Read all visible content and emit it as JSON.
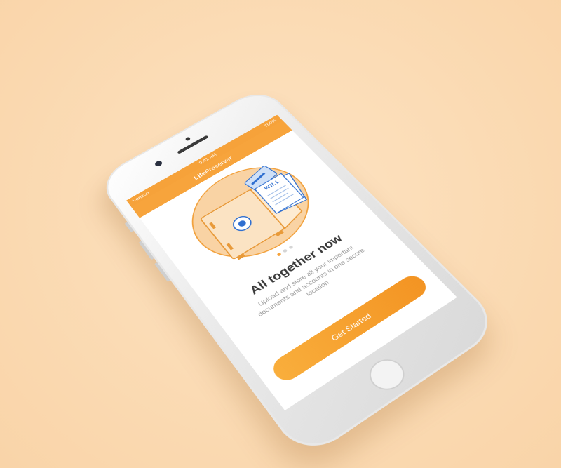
{
  "status_bar": {
    "carrier": "Verizon",
    "time": "9:41 AM",
    "battery": "100%"
  },
  "nav_bar": {
    "app_name_bold": "Life",
    "app_name_rest": "Preserver"
  },
  "illustration": {
    "document_label": "WILL"
  },
  "pager": {
    "count": 3,
    "active_index": 0
  },
  "onboarding": {
    "title": "All together now",
    "description": "Upload and store all your important documents and accounts in one secure location"
  },
  "cta": {
    "label": "Get Started"
  },
  "colors": {
    "accent": "#f6a23a",
    "background": "#fbdcb6"
  }
}
